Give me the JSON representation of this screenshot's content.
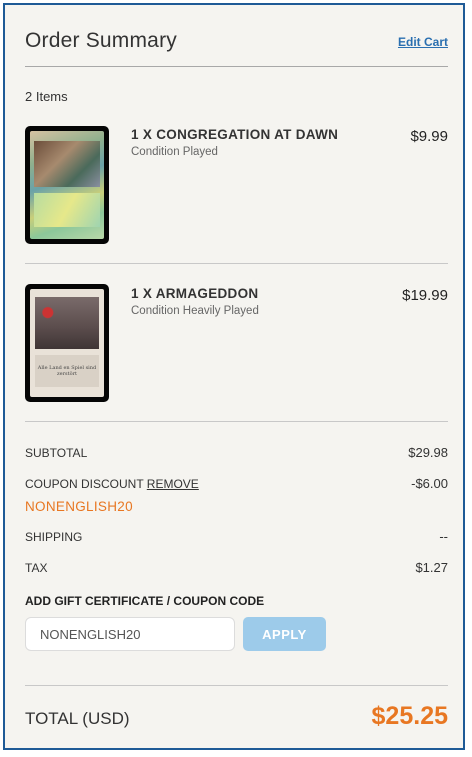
{
  "header": {
    "title": "Order Summary",
    "edit_cart_label": "Edit Cart"
  },
  "items_count": "2 Items",
  "items": [
    {
      "name": "1 X CONGREGATION AT DAWN",
      "condition": "Condition Played",
      "price": "$9.99",
      "image": "card-congregation-at-dawn"
    },
    {
      "name": "1 X ARMAGEDDON",
      "condition": "Condition Heavily Played",
      "price": "$19.99",
      "image": "card-armageddon"
    }
  ],
  "summary": {
    "subtotal_label": "SUBTOTAL",
    "subtotal_value": "$29.98",
    "coupon_label": "COUPON DISCOUNT",
    "coupon_remove_label": "REMOVE",
    "coupon_value": "-$6.00",
    "coupon_code": "NONENGLISH20",
    "shipping_label": "SHIPPING",
    "shipping_value": "--",
    "tax_label": "TAX",
    "tax_value": "$1.27"
  },
  "coupon_form": {
    "label": "ADD GIFT CERTIFICATE / COUPON CODE",
    "input_value": "NONENGLISH20",
    "apply_label": "APPLY"
  },
  "total": {
    "label": "TOTAL (USD)",
    "value": "$25.25"
  },
  "card_text": {
    "armageddon": "Alle Land en Spiel sind zerstört"
  },
  "colors": {
    "accent": "#e87722",
    "link": "#2a6fb0",
    "border": "#1e5a96",
    "apply_button": "#9dcbea"
  }
}
